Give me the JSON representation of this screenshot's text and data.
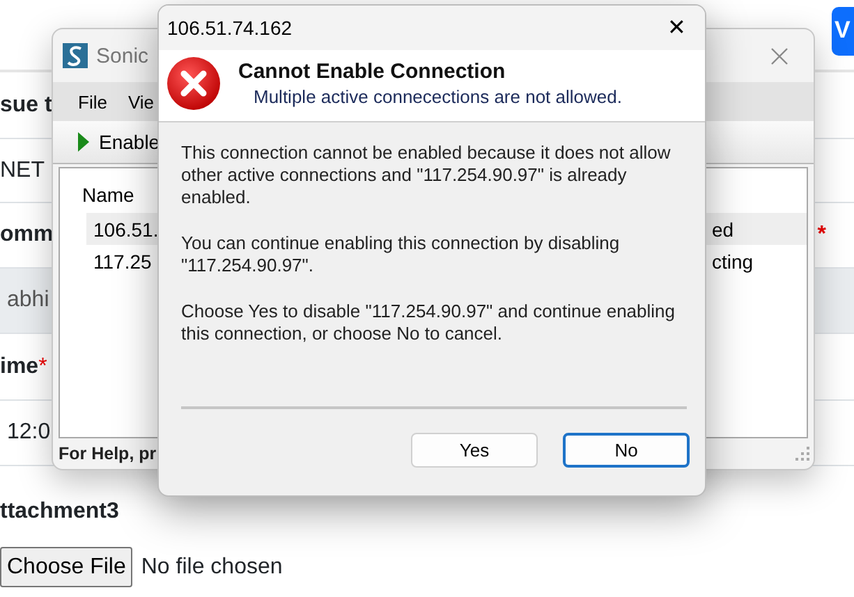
{
  "web_page": {
    "header_button": {
      "label": "V"
    },
    "rows": [
      {
        "kind": "label",
        "text": "sue t"
      },
      {
        "kind": "value",
        "text": "NET"
      },
      {
        "kind": "label",
        "text": "omm",
        "side_mark": "*"
      },
      {
        "kind": "input",
        "text": "abhi"
      },
      {
        "kind": "label",
        "text": "ime",
        "mark": "*"
      },
      {
        "kind": "value",
        "text": "12:0"
      }
    ],
    "attachment": {
      "label": "ttachment3",
      "button": "Choose File",
      "status": "No file chosen"
    }
  },
  "app_window": {
    "title": "Sonic",
    "menu": [
      "File",
      "Vie"
    ],
    "toolbar": [
      {
        "label": "Enable"
      }
    ],
    "list": {
      "column": "Name",
      "rows": [
        {
          "name": "106.51.",
          "status": "ed",
          "selected": true
        },
        {
          "name": "117.25",
          "status": "cting",
          "selected": false
        }
      ]
    },
    "status_bar": "For Help, pr"
  },
  "dialog": {
    "title": "106.51.74.162",
    "close": "✕",
    "heading": "Cannot Enable Connection",
    "subheading": "Multiple active connecections are not allowed.",
    "paragraphs": [
      "This connection cannot be enabled because it does not allow other active connections and \"117.254.90.97\" is already enabled.",
      "You can continue enabling this connection by disabling \"117.254.90.97\".",
      "Choose Yes to disable \"117.254.90.97\" and continue enabling this connection, or choose No to cancel."
    ],
    "buttons": [
      {
        "label": "Yes",
        "default": false
      },
      {
        "label": "No",
        "default": true
      }
    ]
  }
}
